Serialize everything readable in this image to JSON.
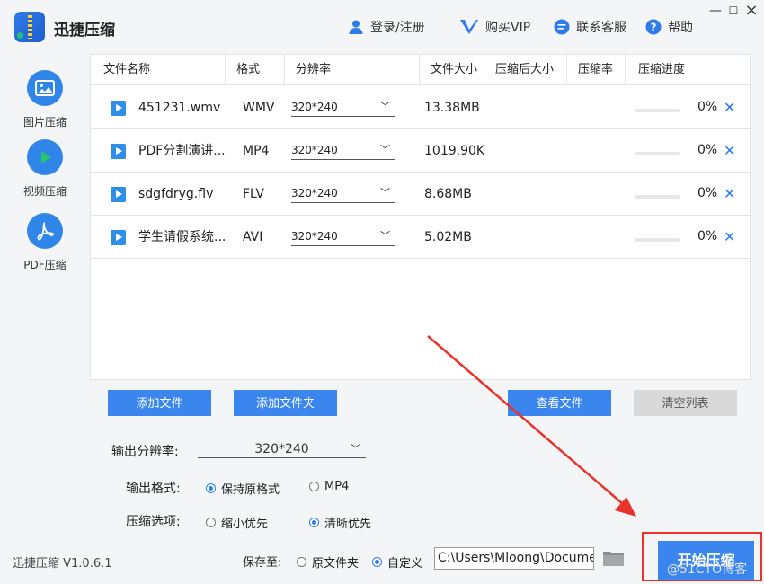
{
  "app": {
    "title": "迅捷压缩",
    "login_label": "登录/注册",
    "vip_label": "购买VIP",
    "support_label": "联系客服",
    "help_label": "帮助",
    "minimize": "—",
    "close": "×"
  },
  "sidebar": {
    "items": [
      {
        "label": "图片压缩",
        "icon": "image-icon"
      },
      {
        "label": "视频压缩",
        "icon": "play-icon"
      },
      {
        "label": "PDF压缩",
        "icon": "pdf-icon"
      }
    ]
  },
  "table": {
    "headers": [
      "文件名称",
      "格式",
      "分辨率",
      "文件大小",
      "压缩后大小",
      "压缩率",
      "压缩进度"
    ],
    "rows": [
      {
        "name": "451231.wmv",
        "format": "WMV",
        "resolution": "320*240",
        "size": "13.38MB",
        "progress": "0%"
      },
      {
        "name": "PDF分割演讲...",
        "format": "MP4",
        "resolution": "320*240",
        "size": "1019.90KB",
        "progress": "0%"
      },
      {
        "name": "sdgfdryg.flv",
        "format": "FLV",
        "resolution": "320*240",
        "size": "8.68MB",
        "progress": "0%"
      },
      {
        "name": "学生请假系统...",
        "format": "AVI",
        "resolution": "320*240",
        "size": "5.02MB",
        "progress": "0%"
      }
    ]
  },
  "actions": {
    "add_file": "添加文件",
    "add_folder": "添加文件夹",
    "view_files": "查看文件",
    "clear_list": "清空列表"
  },
  "options": {
    "output_resolution_label": "输出分辨率:",
    "output_resolution_value": "320*240",
    "output_format_label": "输出格式:",
    "format_keep": "保持原格式",
    "format_mp4": "MP4",
    "compress_label": "压缩选项:",
    "compress_small": "缩小优先",
    "compress_clear": "清晰优先"
  },
  "bottom": {
    "version": "迅捷压缩 V1.0.6.1",
    "save_to_label": "保存至:",
    "save_original": "原文件夹",
    "save_custom": "自定义",
    "path_value": "C:\\Users\\Mloong\\Documents",
    "start_button": "开始压缩",
    "watermark": "@51CTO博客"
  },
  "colors": {
    "accent": "#3a86ee",
    "annotation_red": "#e8322a"
  }
}
